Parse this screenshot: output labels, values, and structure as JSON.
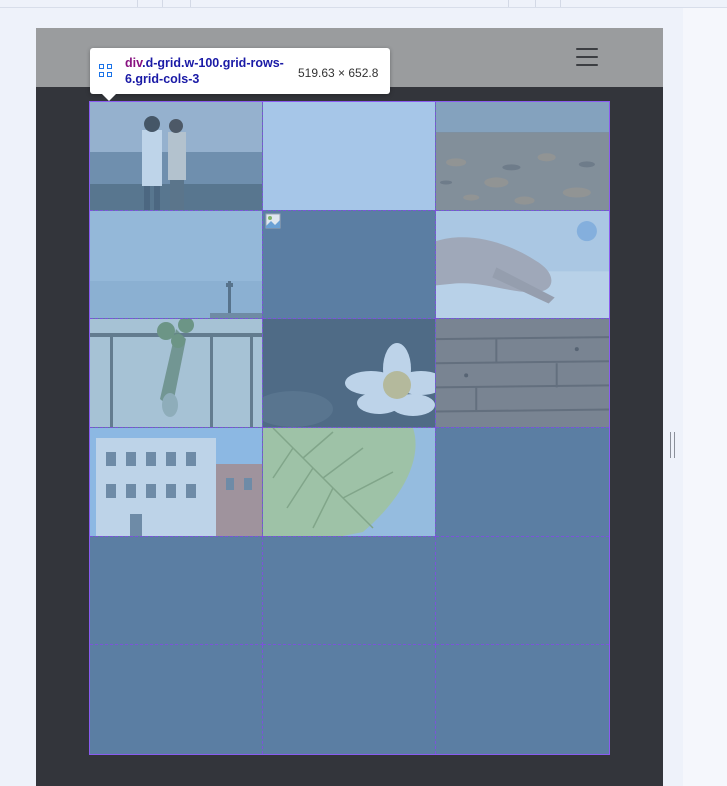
{
  "devtools": {
    "tooltip": {
      "tag": "div",
      "classes": ".d-grid.w-100.grid-rows-6.grid-cols-3",
      "size": "519.63 × 652.8"
    },
    "grid_overlay_color": "#6fa8dc",
    "grid_line_color": "#7b54d9"
  },
  "page": {
    "navbar": {
      "menu_icon": "hamburger-menu-icon"
    },
    "grid": {
      "rows": 6,
      "cols": 3,
      "cells": [
        {
          "content": "photo: couple by the sea"
        },
        {
          "content": "photo: blank light blue"
        },
        {
          "content": "photo: dry leaves on ground"
        },
        {
          "content": "photo: calm sea with pier"
        },
        {
          "content": "broken image"
        },
        {
          "content": "photo: hand on table"
        },
        {
          "content": "photo: plant in vase by railing"
        },
        {
          "content": "photo: white water lily"
        },
        {
          "content": "photo: wooden planks"
        },
        {
          "content": "photo: white building facade"
        },
        {
          "content": "photo: green leaf"
        },
        {
          "content": "empty"
        },
        {
          "content": "empty"
        },
        {
          "content": "empty"
        },
        {
          "content": "empty"
        },
        {
          "content": "empty"
        },
        {
          "content": "empty"
        },
        {
          "content": "empty"
        }
      ]
    }
  }
}
